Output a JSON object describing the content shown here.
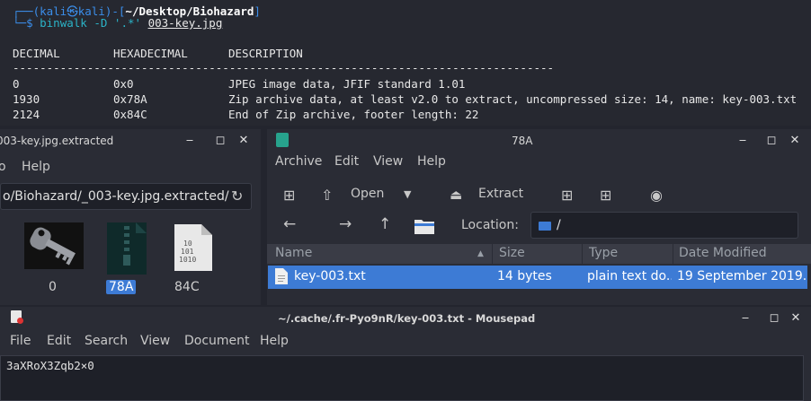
{
  "terminal": {
    "prompt_user": "kali",
    "prompt_at": "㉿",
    "prompt_host": "kali",
    "prompt_path": "~/Desktop/Biohazard",
    "command_name": "binwalk",
    "command_args": "-D '.*'",
    "command_file": "003-key.jpg",
    "headers": {
      "decimal": "DECIMAL",
      "hex": "HEXADECIMAL",
      "desc": "DESCRIPTION"
    },
    "separator": "--------------------------------------------------------------------------------",
    "rows": [
      {
        "decimal": "0",
        "hex": "0x0",
        "desc": "JPEG image data, JFIF standard 1.01"
      },
      {
        "decimal": "1930",
        "hex": "0x78A",
        "desc": "Zip archive data, at least v2.0 to extract, uncompressed size: 14, name: key-003.txt"
      },
      {
        "decimal": "2124",
        "hex": "0x84C",
        "desc": "End of Zip archive, footer length: 22"
      }
    ]
  },
  "file_manager": {
    "title": "003-key.jpg.extracted",
    "menu": [
      "o",
      "Help"
    ],
    "path": "o/Biohazard/_003-key.jpg.extracted/",
    "files": [
      {
        "label": "0",
        "icon": "key-image-icon",
        "selected": false
      },
      {
        "label": "78A",
        "icon": "zip-archive-icon",
        "selected": true
      },
      {
        "label": "84C",
        "icon": "binary-file-icon",
        "selected": false
      }
    ]
  },
  "archive_manager": {
    "title": "78A",
    "menu": [
      "Archive",
      "Edit",
      "View",
      "Help"
    ],
    "toolbar": {
      "open": "Open",
      "extract": "Extract"
    },
    "location_label": "Location:",
    "location_value": "/",
    "columns": [
      "Name",
      "Size",
      "Type",
      "Date Modified"
    ],
    "rows": [
      {
        "name": "key-003.txt",
        "size": "14 bytes",
        "type": "plain text do...",
        "date": "19 September 2019..."
      }
    ]
  },
  "mousepad": {
    "title": "~/.cache/.fr-Pyo9nR/key-003.txt - Mousepad",
    "menu": [
      "File",
      "Edit",
      "Search",
      "View",
      "Document",
      "Help"
    ],
    "content": "3aXRoX3Zqb2×0"
  },
  "colors": {
    "accent": "#3d7bd5",
    "prompt_blue": "#3b8eea",
    "command_cyan": "#2bb3c7"
  }
}
